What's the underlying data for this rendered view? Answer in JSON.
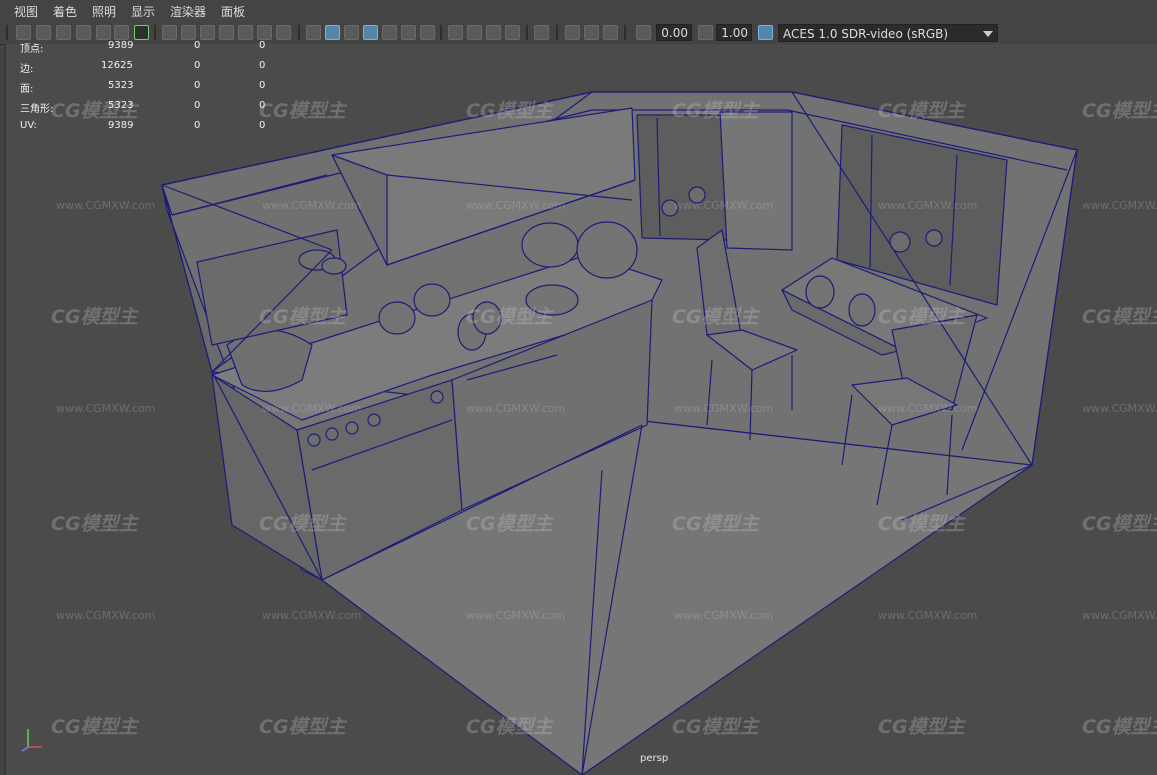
{
  "menu": {
    "items": [
      "视图",
      "着色",
      "照明",
      "显示",
      "渲染器",
      "面板"
    ]
  },
  "toolbar": {
    "exposure": "0.00",
    "gamma": "1.00",
    "color_space": "ACES 1.0 SDR-video (sRGB)"
  },
  "stats": {
    "rows": [
      {
        "label": "顶点:",
        "v1": "9389",
        "v2": "0",
        "v3": "0"
      },
      {
        "label": "边:",
        "v1": "12625",
        "v2": "0",
        "v3": "0"
      },
      {
        "label": "面:",
        "v1": "5323",
        "v2": "0",
        "v3": "0"
      },
      {
        "label": "三角形:",
        "v1": "5323",
        "v2": "0",
        "v3": "0"
      },
      {
        "label": "UV:",
        "v1": "9389",
        "v2": "0",
        "v3": "0"
      }
    ]
  },
  "viewport": {
    "camera": "persp"
  },
  "watermark": {
    "brand": "CG模型主",
    "url": "www.CGMXW.com"
  },
  "colors": {
    "wire": "#1c1c78",
    "bg": "#4b4b4b",
    "surface": "#747474"
  }
}
